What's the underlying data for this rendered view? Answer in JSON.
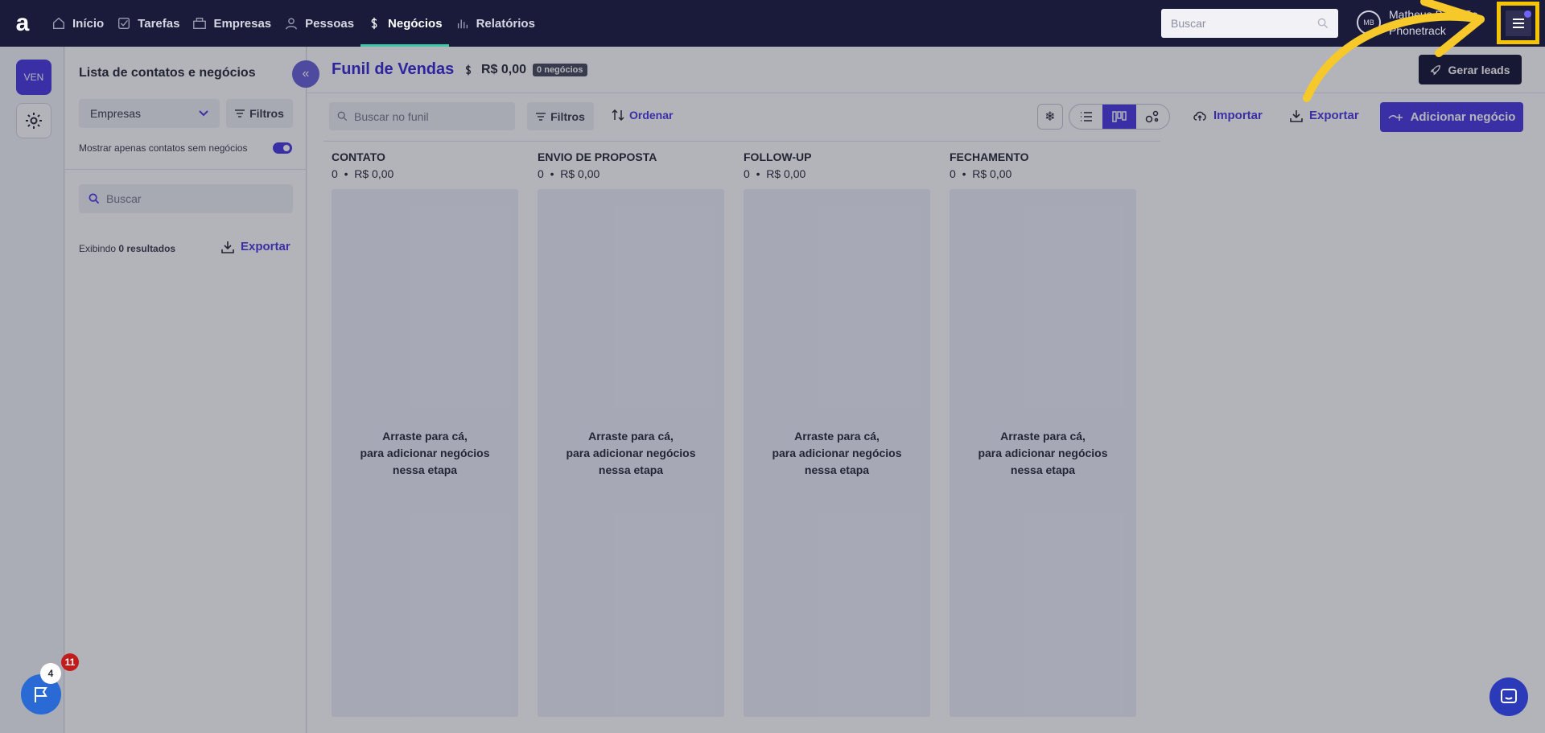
{
  "logo": "a",
  "nav": {
    "items": [
      {
        "label": "Início",
        "icon": "home-icon"
      },
      {
        "label": "Tarefas",
        "icon": "check-icon"
      },
      {
        "label": "Empresas",
        "icon": "building-icon"
      },
      {
        "label": "Pessoas",
        "icon": "person-icon"
      },
      {
        "label": "Negócios",
        "icon": "dollar-icon"
      },
      {
        "label": "Relatórios",
        "icon": "chart-icon"
      }
    ],
    "search_placeholder": "Buscar",
    "user_initials": "MB",
    "user_name": "Matheus Brandão",
    "user_company": "Phonetrack"
  },
  "rail": {
    "ven": "VEN"
  },
  "side": {
    "title": "Lista de contatos e negócios",
    "select_value": "Empresas",
    "filter_label": "Filtros",
    "toggle_label": "Mostrar apenas contatos sem negócios",
    "search_placeholder": "Buscar",
    "count_prefix": "Exibindo",
    "count_value": "0 resultados",
    "export_label": "Exportar"
  },
  "main": {
    "title": "Funil de Vendas",
    "value": "R$ 0,00",
    "badge": "0 negócios",
    "gerar_label": "Gerar leads",
    "search_placeholder": "Buscar no funil",
    "filter_label": "Filtros",
    "order_label": "Ordenar",
    "import_label": "Importar",
    "export_label": "Exportar",
    "add_label": "Adicionar negócio",
    "columns": [
      {
        "name": "CONTATO",
        "count": "0",
        "sum": "R$ 0,00"
      },
      {
        "name": "ENVIO DE PROPOSTA",
        "count": "0",
        "sum": "R$ 0,00"
      },
      {
        "name": "FOLLOW-UP",
        "count": "0",
        "sum": "R$ 0,00"
      },
      {
        "name": "FECHAMENTO",
        "count": "0",
        "sum": "R$ 0,00"
      }
    ],
    "empty_line1": "Arraste para cá,",
    "empty_line2": "para adicionar negócios",
    "empty_line3": "nessa etapa"
  },
  "floating": {
    "flag_count": "4",
    "badge_count": "11"
  },
  "colors": {
    "nav_bg": "#1a1b3a",
    "accent": "#4d3ce0",
    "highlight": "#f5c400"
  }
}
